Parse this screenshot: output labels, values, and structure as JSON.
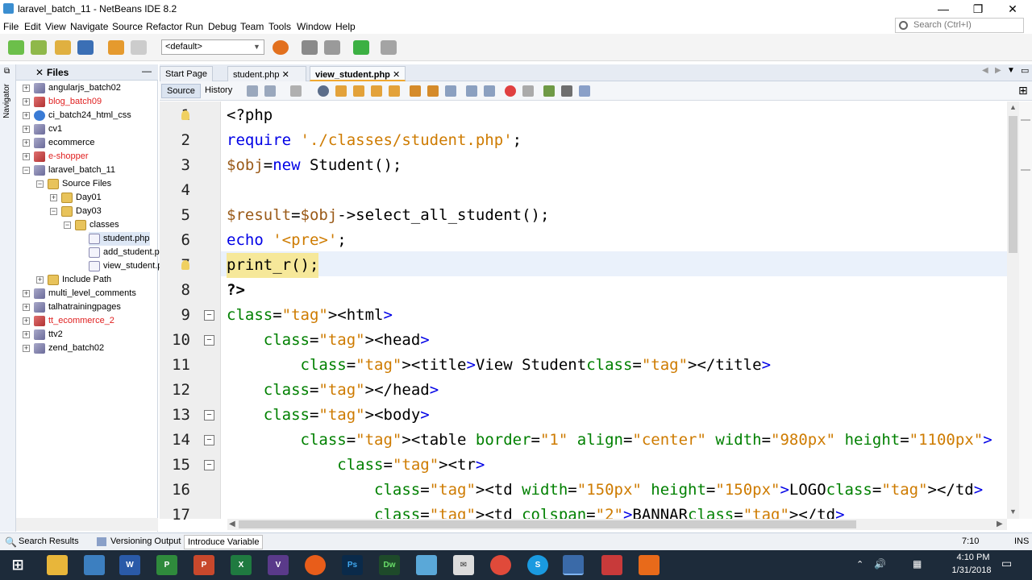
{
  "window": {
    "title": "laravel_batch_11 - NetBeans IDE 8.2",
    "minimize": "—",
    "restore": "❐",
    "close": "✕"
  },
  "menu": [
    "File",
    "Edit",
    "View",
    "Navigate",
    "Source",
    "Refactor",
    "Run",
    "Debug",
    "Team",
    "Tools",
    "Window",
    "Help"
  ],
  "toolbar": {
    "config": "<default>",
    "search_placeholder": "Search (Ctrl+I)"
  },
  "nav": {
    "navigator_label": "Navigator"
  },
  "files": {
    "title": "Files",
    "tree": [
      {
        "label": "angularjs_batch02",
        "red": false
      },
      {
        "label": "blog_batch09",
        "red": true
      },
      {
        "label": "ci_batch24_html_css",
        "red": false
      },
      {
        "label": "cv1",
        "red": false
      },
      {
        "label": "ecommerce",
        "red": false
      },
      {
        "label": "e-shopper",
        "red": true
      },
      {
        "label": "laravel_batch_11",
        "red": false
      },
      {
        "label": "Source Files",
        "red": false
      },
      {
        "label": "Day01",
        "red": false
      },
      {
        "label": "Day03",
        "red": false
      },
      {
        "label": "classes",
        "red": false
      },
      {
        "label": "student.php",
        "red": false
      },
      {
        "label": "add_student.php",
        "red": false
      },
      {
        "label": "view_student.php",
        "red": false
      },
      {
        "label": "Include Path",
        "red": false
      },
      {
        "label": "multi_level_comments",
        "red": false
      },
      {
        "label": "talhatrainingpages",
        "red": false
      },
      {
        "label": "tt_ecommerce_2",
        "red": true
      },
      {
        "label": "ttv2",
        "red": false
      },
      {
        "label": "zend_batch02",
        "red": false
      }
    ]
  },
  "editor": {
    "tabs": [
      "Start Page",
      "student.php",
      "view_student.php"
    ],
    "active_tab": "view_student.php",
    "source_label": "Source",
    "history_label": "History",
    "line_numbers": [
      "1",
      "2",
      "3",
      "4",
      "5",
      "6",
      "7",
      "8",
      "9",
      "10",
      "11",
      "12",
      "13",
      "14",
      "15",
      "16",
      "17"
    ],
    "lines": [
      "<?php",
      "require './classes/student.php';",
      "$obj=new Student();",
      "",
      "$result=$obj->select_all_student();",
      "echo '<pre>';",
      "print_r();",
      "?>",
      "<html>",
      "    <head>",
      "        <title>View Student</title>",
      "    </head>",
      "    <body>",
      "        <table border=\"1\" align=\"center\" width=\"980px\" height=\"1100px\">",
      "            <tr>",
      "                <td width=\"150px\" height=\"150px\">LOGO</td>",
      "                <td colspan=\"2\">BANNAR</td>"
    ]
  },
  "bottom": {
    "search_results": "Search Results",
    "versioning_output": "Versioning Output",
    "introduce_variable": "Introduce Variable",
    "cursor_pos": "7:10",
    "insert_mode": "INS"
  },
  "taskbar": {
    "time": "4:10 PM",
    "date": "1/31/2018"
  }
}
